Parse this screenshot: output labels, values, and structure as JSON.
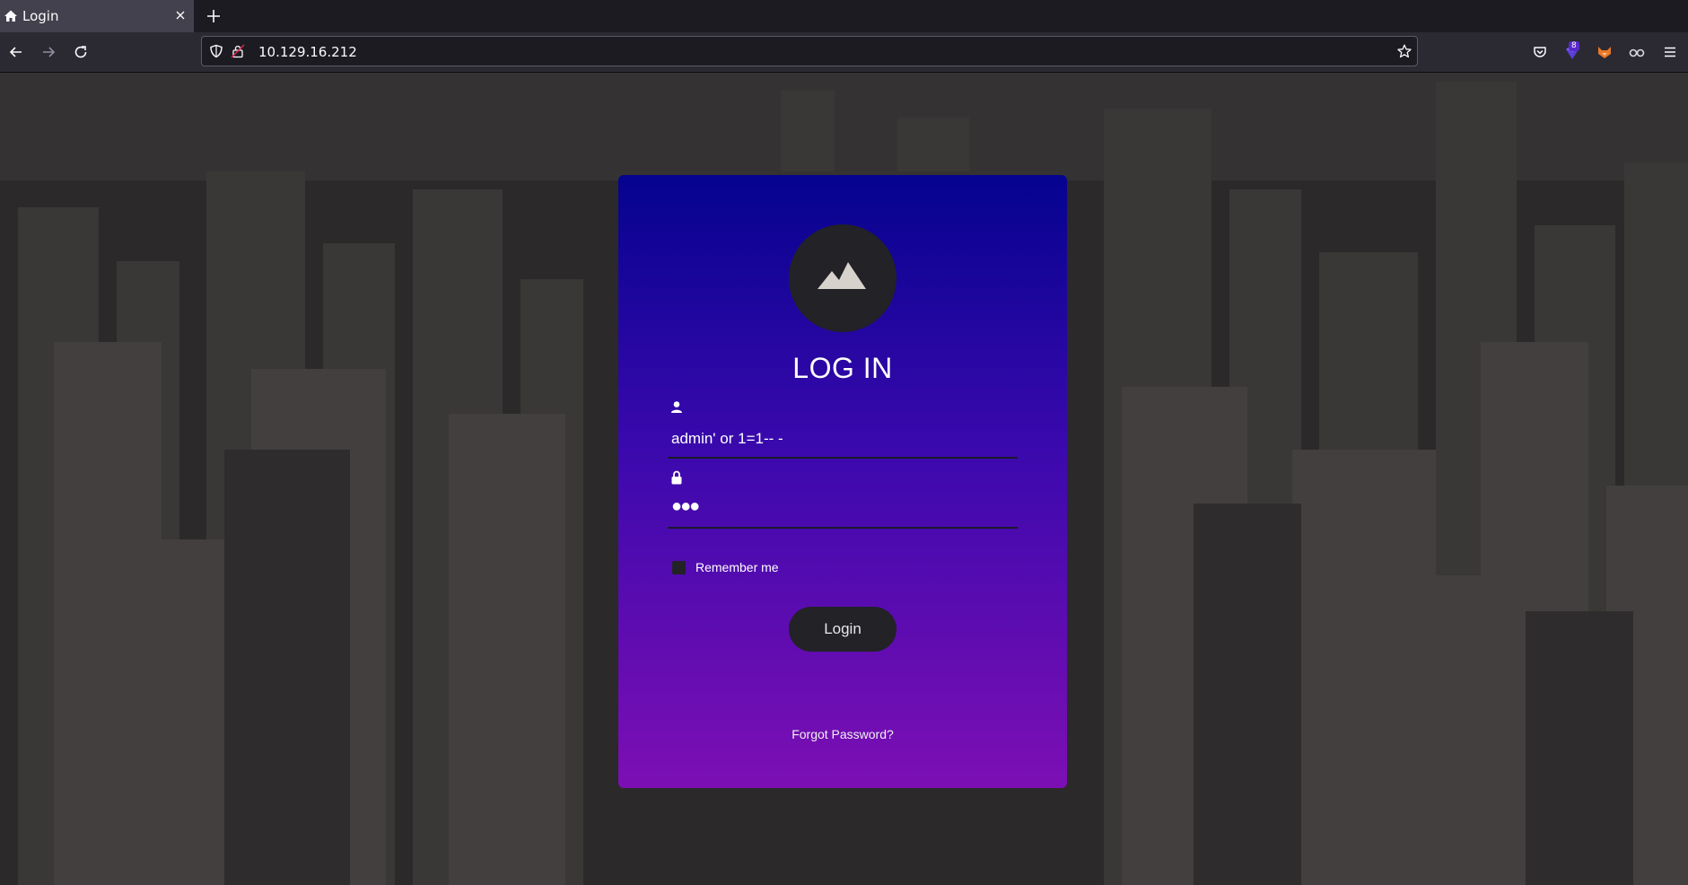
{
  "browser": {
    "tab": {
      "title": "Login",
      "favicon": "home-icon"
    },
    "url": "10.129.16.212",
    "extension_badge": "8",
    "icons": {
      "back": "arrow-left-icon",
      "forward": "arrow-right-icon",
      "reload": "reload-icon",
      "shield": "shield-icon",
      "lock": "lock-icon",
      "bookmark": "star-icon",
      "pocket": "pocket-icon",
      "menu": "hamburger-icon"
    }
  },
  "login": {
    "title": "LOG IN",
    "username_value": "admin' or 1=1-- -",
    "password_value": "●●●",
    "remember_label": "Remember me",
    "submit_label": "Login",
    "forgot_label": "Forgot Password?"
  },
  "colors": {
    "card_top": "#05038f",
    "card_bottom": "#7c0fb4",
    "button_bg": "#222227"
  }
}
